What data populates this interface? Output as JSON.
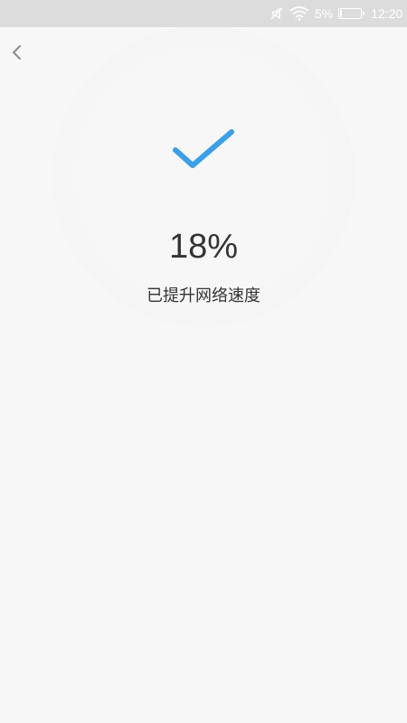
{
  "status_bar": {
    "battery_percent": "5%",
    "time": "12:20",
    "icons": [
      "mute-icon",
      "wifi-icon",
      "battery-icon"
    ]
  },
  "header": {
    "back_icon": "chevron-left-icon"
  },
  "result": {
    "icon": "checkmark-icon",
    "accent_color": "#3aa0e8",
    "percent": "18%",
    "message": "已提升网络速度"
  }
}
